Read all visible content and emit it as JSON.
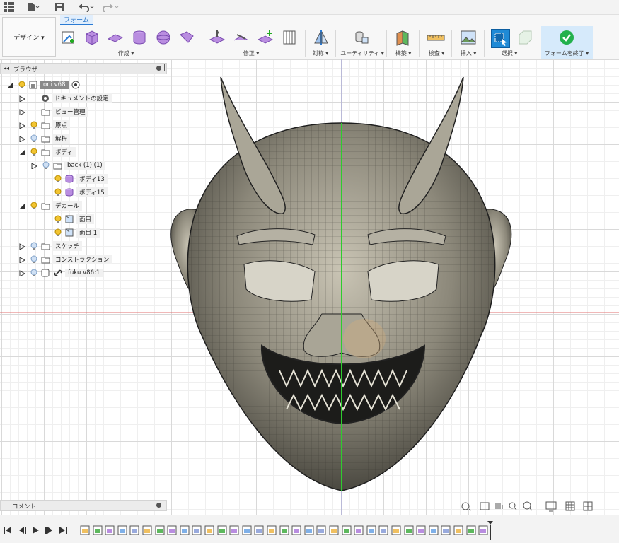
{
  "quickbar": {
    "icons": [
      "grid-icon",
      "file-icon",
      "save-icon",
      "undo-icon",
      "redo-icon"
    ]
  },
  "ribbon": {
    "workspace_label": "デザイン ▾",
    "active_tab": "フォーム",
    "groups": [
      {
        "label": "作成 ▾"
      },
      {
        "label": "修正 ▾"
      },
      {
        "label": "対称 ▾"
      },
      {
        "label": "ユーティリティ ▾"
      },
      {
        "label": "構築 ▾"
      },
      {
        "label": "検査 ▾"
      },
      {
        "label": "挿入 ▾"
      },
      {
        "label": "選択 ▾"
      },
      {
        "label": "フォームを終了 ▾"
      }
    ]
  },
  "browser": {
    "title": "ブラウザ",
    "items": [
      {
        "label": "oni v68",
        "level": 0,
        "expanded": true,
        "kind": "root"
      },
      {
        "label": "ドキュメントの設定",
        "level": 1,
        "expanded": false,
        "kind": "settings"
      },
      {
        "label": "ビュー管理",
        "level": 1,
        "expanded": false,
        "kind": "folder"
      },
      {
        "label": "原点",
        "level": 1,
        "expanded": false,
        "kind": "folder-bulb"
      },
      {
        "label": "解析",
        "level": 1,
        "expanded": false,
        "kind": "folder-bulb"
      },
      {
        "label": "ボディ",
        "level": 1,
        "expanded": true,
        "kind": "folder-bulb"
      },
      {
        "label": "back (1) (1)",
        "level": 2,
        "expanded": false,
        "kind": "folder-bulb"
      },
      {
        "label": "ボディ13",
        "level": 3,
        "expanded": null,
        "kind": "body"
      },
      {
        "label": "ボディ15",
        "level": 3,
        "expanded": null,
        "kind": "body"
      },
      {
        "label": "デカール",
        "level": 1,
        "expanded": true,
        "kind": "folder-bulb"
      },
      {
        "label": "面目",
        "level": 3,
        "expanded": null,
        "kind": "decal"
      },
      {
        "label": "面目 1",
        "level": 3,
        "expanded": null,
        "kind": "decal"
      },
      {
        "label": "スケッチ",
        "level": 1,
        "expanded": false,
        "kind": "folder-bulb"
      },
      {
        "label": "コンストラクション",
        "level": 1,
        "expanded": false,
        "kind": "folder-bulb"
      },
      {
        "label": "fuku v86:1",
        "level": 1,
        "expanded": false,
        "kind": "link"
      }
    ]
  },
  "comments": {
    "label": "コメント"
  },
  "timeline": {
    "feature_count": 33
  },
  "colors": {
    "accent": "#2b7bd4",
    "finish_green": "#22b14c",
    "axis_green": "#2ecc2e",
    "axis_red": "#e07070",
    "mesh_fill": "#7d7a6e"
  }
}
